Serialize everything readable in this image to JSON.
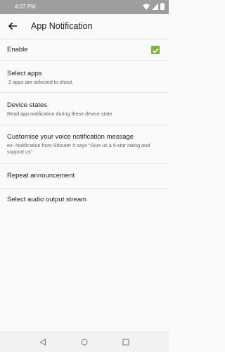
{
  "status": {
    "time": "4:07 PM"
  },
  "app_bar": {
    "title": "App Notification"
  },
  "settings": {
    "enable": {
      "label": "Enable",
      "checked": true
    },
    "select_apps": {
      "label": "Select apps",
      "summary": " 2 apps are selected to shout."
    },
    "device_states": {
      "label": "Device states",
      "summary": "Read app notification during these device state"
    },
    "customise": {
      "label": "Customise your voice notification message",
      "summary": "ex- Notification from Shouter It says \"Give us a 5-star rating and support us\""
    },
    "repeat": {
      "label": "Repeat announcement"
    },
    "audio_stream": {
      "label": "Select audio output stream"
    }
  },
  "colors": {
    "accent": "#7cb342",
    "status_bar": "#9e9e9e"
  },
  "icons": [
    "wifi-icon",
    "signal-icon",
    "battery-icon",
    "back-arrow-icon",
    "checkmark-icon",
    "nav-back-icon",
    "nav-home-icon",
    "nav-recents-icon"
  ]
}
